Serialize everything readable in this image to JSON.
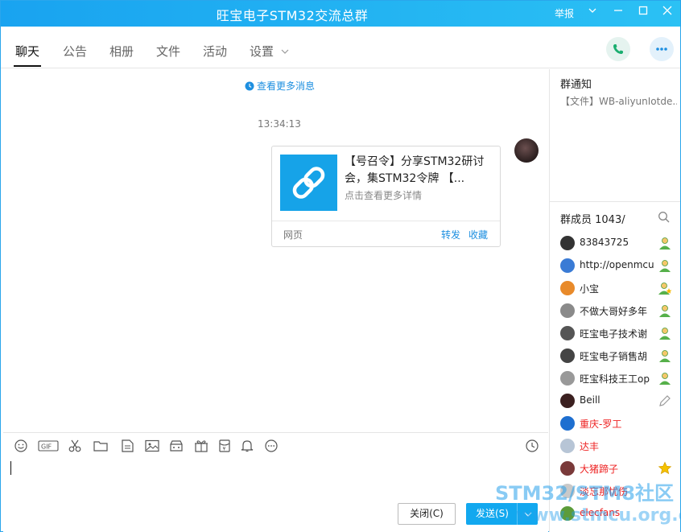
{
  "window": {
    "title": "旺宝电子STM32交流总群",
    "report": "举报",
    "min_icon": "minimize-icon",
    "max_icon": "maximize-icon",
    "close_icon": "close-icon"
  },
  "tabs": [
    {
      "label": "聊天",
      "active": true
    },
    {
      "label": "公告"
    },
    {
      "label": "相册"
    },
    {
      "label": "文件"
    },
    {
      "label": "活动"
    },
    {
      "label": "设置"
    }
  ],
  "chat": {
    "more_messages": "查看更多消息",
    "timestamp": "13:34:13",
    "card": {
      "title": "【号召令】分享STM32研讨会，集STM32令牌 【...",
      "subtitle": "点击查看更多详情",
      "source": "网页",
      "forward": "转发",
      "favorite": "收藏"
    }
  },
  "input": {
    "close_label": "关闭(C)",
    "send_label": "发送(S)"
  },
  "sidebar": {
    "notice_title": "群通知",
    "notice_body": "【文件】WB-aliyunIotde...",
    "members_title": "群成员 1043/",
    "members": [
      {
        "name": "83843725",
        "red": false,
        "avatar": "#333333",
        "badge": "admin"
      },
      {
        "name": "http://openmcu",
        "red": false,
        "avatar": "#3a7bd5",
        "badge": "admin"
      },
      {
        "name": "小宝",
        "red": false,
        "avatar": "#e88a2a",
        "badge": "admin-star"
      },
      {
        "name": "不做大哥好多年",
        "red": false,
        "avatar": "#8a8a8a",
        "badge": "admin"
      },
      {
        "name": "旺宝电子技术谢",
        "red": false,
        "avatar": "#555555",
        "badge": "admin"
      },
      {
        "name": "旺宝电子销售胡",
        "red": false,
        "avatar": "#444444",
        "badge": "admin"
      },
      {
        "name": "旺宝科技王工op",
        "red": false,
        "avatar": "#999999",
        "badge": "admin"
      },
      {
        "name": "Beill",
        "red": false,
        "avatar": "#3b2020",
        "badge": "edit"
      },
      {
        "name": "重庆-罗工",
        "red": true,
        "avatar": "#1e6fd0",
        "badge": ""
      },
      {
        "name": "达丰",
        "red": true,
        "avatar": "#b7c5d6",
        "badge": ""
      },
      {
        "name": "大猪蹄子",
        "red": true,
        "avatar": "#7a3a3a",
        "badge": "star"
      },
      {
        "name": "淡忘那忧伤",
        "red": true,
        "avatar": "#c9c9c9",
        "badge": ""
      },
      {
        "name": "elecfans",
        "red": true,
        "avatar": "#5c9c3a",
        "badge": ""
      }
    ]
  },
  "watermark": {
    "line1": "STM32/STM8社区",
    "line2": "www.stmcu.org.cn"
  },
  "colors": {
    "titlebar": "#19a3f0",
    "accent": "#1d8fe0",
    "send": "#12a8ef",
    "red_name": "#e22222"
  }
}
